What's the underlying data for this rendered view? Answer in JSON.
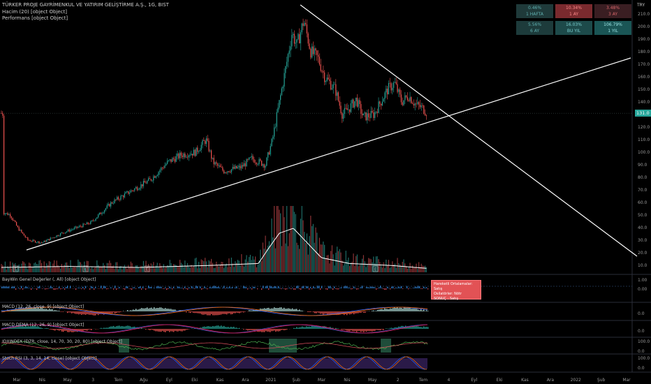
{
  "header": {
    "symbol_line": "TÜRKER PROJE GAYRİMENKUL VE YATIRIM GELİŞTİRME A.Ş., 1G, BIST",
    "volume_label": "Hacim (20) [object Object]",
    "performance_label": "Performans [object Object]"
  },
  "performance": [
    {
      "value": "0.46%",
      "period": "1 HAFTA",
      "color": "#1f3a3a",
      "text": "#5fb0b0"
    },
    {
      "value": "10.34%",
      "period": "1 AY",
      "color": "#7a2a2e",
      "text": "#ff8a8a"
    },
    {
      "value": "3.48%",
      "period": "3 AY",
      "color": "#3a1e22",
      "text": "#d9676a"
    },
    {
      "value": "5.56%",
      "period": "6 AY",
      "color": "#1d3b3b",
      "text": "#5fb0b0"
    },
    {
      "value": "16.03%",
      "period": "BU YIL",
      "color": "#1d4a4a",
      "text": "#7ad0d0"
    },
    {
      "value": "106.79%",
      "period": "1 YIL",
      "color": "#1a5555",
      "text": "#9be5e5"
    }
  ],
  "currency": "TRY",
  "price_axis": [
    "210.0",
    "200.0",
    "190.0",
    "180.0",
    "170.0",
    "160.0",
    "150.0",
    "140.0",
    "130.0",
    "120.0",
    "110.0",
    "100.0",
    "90.0",
    "80.0",
    "70.0",
    "60.0",
    "50.0",
    "40.0",
    "30.0",
    "20.0",
    "10.0"
  ],
  "last_price": "131.0",
  "indicators": [
    {
      "name": "BayWin Genel Değerler (, All) [object Object]",
      "scale": [
        "1.00",
        "0.00"
      ]
    },
    {
      "name": "MACD (12, 26, close, 9) [object Object]",
      "scale": [
        "0.0"
      ]
    },
    {
      "name": "MACD DEMA (12, 26, 9) [object Object]",
      "scale": [
        "0.0"
      ]
    },
    {
      "name": "IDXINDEX (DZR, close, 14, 70, 30, 20, 80) [object Object]",
      "scale": [
        "100.0",
        "0.0"
      ]
    },
    {
      "name": "Stoch RSI (3, 3, 14, 14, close) [object Object]",
      "scale": [
        "100.0",
        "0.0"
      ]
    }
  ],
  "signal_box": {
    "line1": "Hareketli Ortalamalar:    Satış",
    "line2": "Osilatörler: Nötr",
    "line3": "SONUÇ : Satış"
  },
  "time_axis": [
    "Mar",
    "Nis",
    "May",
    "3",
    "Tem",
    "Ağu",
    "Eyl",
    "Eki",
    "Kas",
    "Ara",
    "2021",
    "Şub",
    "Mar",
    "Nis",
    "May",
    "2",
    "Tem",
    "4",
    "Eyl",
    "Eki",
    "Kas",
    "Ara",
    "2022",
    "Şub",
    "Mar"
  ],
  "colors": {
    "up": "#26a69a",
    "down": "#ef5350",
    "background": "#000000",
    "trendline": "#ffffff"
  }
}
